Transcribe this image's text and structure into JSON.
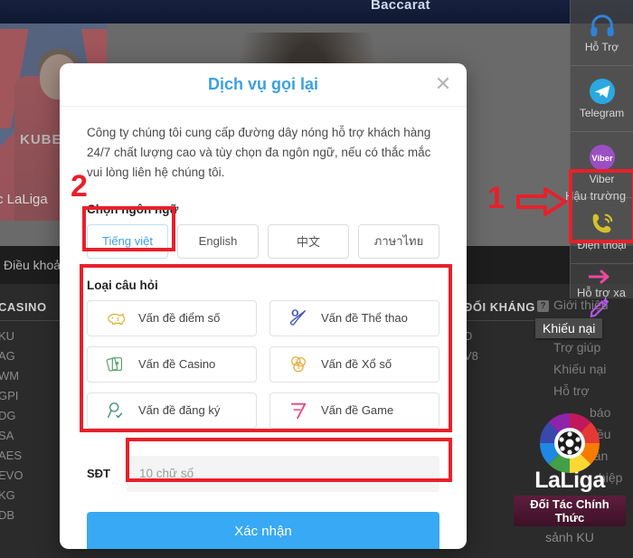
{
  "background": {
    "topbar_title": "Baccarat",
    "terms_label": "Điều khoản",
    "player_jersey_logo": "KUBET",
    "hero_laliga_text": "c LaLiga",
    "left_column": {
      "header": "CASINO",
      "items": [
        "KU",
        "AG",
        "WM",
        "GPI",
        "DG",
        "SA",
        "AES",
        "EVO",
        "KG",
        "DB"
      ]
    },
    "mid_column": {
      "header": "ĐỐI KHÁNG",
      "items": [
        "D",
        "V8"
      ]
    },
    "about_label": "Giới thiệu",
    "about_icon": "help-badge-icon",
    "tooltip": "Khiếu nại",
    "edit_icon": "edit-pencil-icon",
    "footer_links": [
      "Trợ giúp",
      "Khiếu nại",
      "Hỗ trợ",
      "báo",
      "ều",
      "thần",
      "hiệp",
      "sảnh KU"
    ],
    "laliga": {
      "wordmark": "LaLiga",
      "banner": "Đối Tác Chính Thức",
      "subtext": "sảnh KU",
      "mark_icon": "laliga-football-icon"
    }
  },
  "support_rail": {
    "items": [
      {
        "label": "Hỗ Trợ",
        "icon": "headphones-icon",
        "color": "#2f83d8"
      },
      {
        "label": "Telegram",
        "icon": "telegram-icon",
        "color": "#2aa8e0"
      },
      {
        "label": "Viber",
        "icon": "viber-icon",
        "color": "#9b4fc4"
      },
      {
        "label": "Điện thoại",
        "icon": "phone-callback-icon",
        "color": "#d4c22a"
      }
    ],
    "overlap_text": "Hậu trường",
    "bottom": {
      "label": "Hỗ trợ xa",
      "icon": "arrow-right-icon",
      "color": "#e84aa0"
    }
  },
  "annotations": {
    "step1": "1",
    "step2": "2",
    "color": "#e8202a",
    "arrow_icon": "red-arrow-right-icon"
  },
  "modal": {
    "title": "Dịch vụ gọi lại",
    "close_icon": "close-icon",
    "intro": "Công ty chúng tôi cung cấp đường dây nóng hỗ trợ khách hàng 24/7 chất lượng cao và tùy chọn đa ngôn ngữ, nếu có thắc mắc vui lòng liên hệ chúng tôi.",
    "language_section": {
      "label": "Chọn ngôn ngữ",
      "selected": "Tiếng việt",
      "options": [
        "Tiếng việt",
        "English",
        "中文",
        "ภาษาไทย"
      ]
    },
    "question_section": {
      "label": "Loại câu hỏi",
      "options": [
        {
          "label": "Vấn đề điểm số",
          "icon": "piggy-bank-icon",
          "color": "#d9b43c"
        },
        {
          "label": "Vấn đề Thể thao",
          "icon": "baseball-bat-icon",
          "color": "#4455b8"
        },
        {
          "label": "Vấn đề Casino",
          "icon": "playing-cards-icon",
          "color": "#5aa06a"
        },
        {
          "label": "Vấn đề Xổ số",
          "icon": "coins-icon",
          "color": "#e8a93a"
        },
        {
          "label": "Vấn đề đăng ký",
          "icon": "person-check-icon",
          "color": "#3a8f7a"
        },
        {
          "label": "Vấn đề Game",
          "icon": "seven-icon",
          "color": "#e8447e"
        }
      ]
    },
    "phone_section": {
      "label": "SĐT",
      "placeholder": "10 chữ số",
      "value": ""
    },
    "submit_label": "Xác nhận",
    "accent_color": "#38a9f4"
  }
}
